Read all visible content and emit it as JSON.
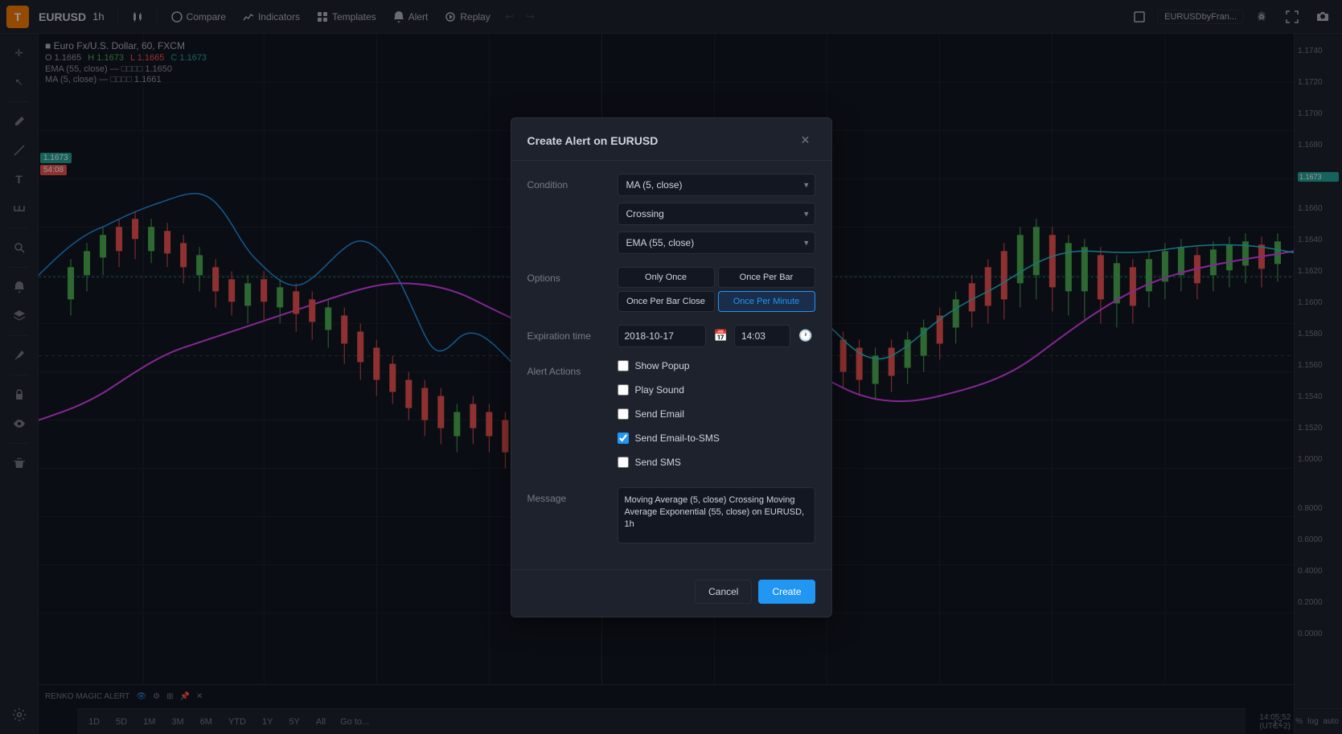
{
  "toolbar": {
    "logo": "T",
    "symbol": "EURUSD",
    "interval": "1h",
    "compare_label": "Compare",
    "indicators_label": "Indicators",
    "templates_label": "Templates",
    "alert_label": "Alert",
    "replay_label": "Replay",
    "pair_display": "EURUSDbyFran...",
    "chart_type_icon": "candle-icon",
    "settings_icon": "gear-icon",
    "fullscreen_icon": "fullscreen-icon",
    "screenshot_icon": "camera-icon"
  },
  "chart_info": {
    "symbol_line": "■ Euro Fx/U.S. Dollar, 60, FXCM",
    "ohlc": {
      "o_label": "O",
      "o_value": "1.1665",
      "h_label": "H",
      "h_value": "1.1673",
      "l_label": "L",
      "l_value": "1.1665",
      "c_label": "C",
      "c_value": "1.1673"
    },
    "ema_line": "EMA (55, close) — □□□□ 1.1650",
    "ma_line": "MA (5, close) — □□□□ 1.1661",
    "renko_label": "RENKO MAGIC ALERT"
  },
  "price_levels": {
    "high": "1.1740",
    "p1": "1.1720",
    "p2": "1.1700",
    "p3": "1.1680",
    "current": "1.1673",
    "p4": "1.1660",
    "p5": "1.1640",
    "p6": "1.1620",
    "p7": "1.1600",
    "p8": "1.1580",
    "p9": "1.1560",
    "p10": "1.1540",
    "p11": "1.1520",
    "low": "1.0000",
    "l2": "0.8000",
    "l3": "0.6000",
    "l4": "0.4000",
    "l5": "0.2000",
    "l6": "0.0000"
  },
  "timeframes": [
    "1D",
    "5D",
    "1M",
    "3M",
    "6M",
    "YTD",
    "1Y",
    "5Y",
    "All"
  ],
  "goto_label": "Go to...",
  "status_bar": {
    "time": "14:05:52 (UTC+2)",
    "scale_options": [
      "%",
      "log",
      "auto"
    ]
  },
  "modal": {
    "title": "Create Alert on EURUSD",
    "condition_label": "Condition",
    "condition_value": "MA (5, close)",
    "crossing_value": "Crossing",
    "ema_value": "EMA (55, close)",
    "options_label": "Options",
    "option_only_once": "Only Once",
    "option_once_per_bar": "Once Per Bar",
    "option_once_per_bar_close": "Once Per Bar Close",
    "option_once_per_minute": "Once Per Minute",
    "expiration_label": "Expiration time",
    "expiration_date": "2018-10-17",
    "expiration_time": "14:03",
    "alert_actions_label": "Alert Actions",
    "show_popup_label": "Show Popup",
    "play_sound_label": "Play Sound",
    "send_email_label": "Send Email",
    "send_email_sms_label": "Send Email-to-SMS",
    "send_sms_label": "Send SMS",
    "show_popup_checked": false,
    "play_sound_checked": false,
    "send_email_checked": false,
    "send_email_sms_checked": true,
    "send_sms_checked": false,
    "message_label": "Message",
    "message_value": "Moving Average (5, close) Crossing Moving Average Exponential (55, close) on EURUSD, 1h",
    "cancel_label": "Cancel",
    "create_label": "Create"
  },
  "sidebar_icons": [
    {
      "name": "crosshair-icon",
      "symbol": "✛"
    },
    {
      "name": "cursor-icon",
      "symbol": "↖"
    },
    {
      "name": "pencil-icon",
      "symbol": "✏"
    },
    {
      "name": "trendline-icon",
      "symbol": "╱"
    },
    {
      "name": "text-icon",
      "symbol": "T"
    },
    {
      "name": "measure-icon",
      "symbol": "⟺"
    },
    {
      "name": "zoom-icon",
      "symbol": "🔍"
    },
    {
      "name": "alert-sidebar-icon",
      "symbol": "🔔"
    },
    {
      "name": "layers-icon",
      "symbol": "⧉"
    },
    {
      "name": "brush-icon",
      "symbol": "🖌"
    },
    {
      "name": "lock-icon",
      "symbol": "🔒"
    },
    {
      "name": "eye-icon",
      "symbol": "👁"
    },
    {
      "name": "trash-icon",
      "symbol": "🗑"
    },
    {
      "name": "settings-sidebar-icon",
      "symbol": "⚙"
    }
  ]
}
